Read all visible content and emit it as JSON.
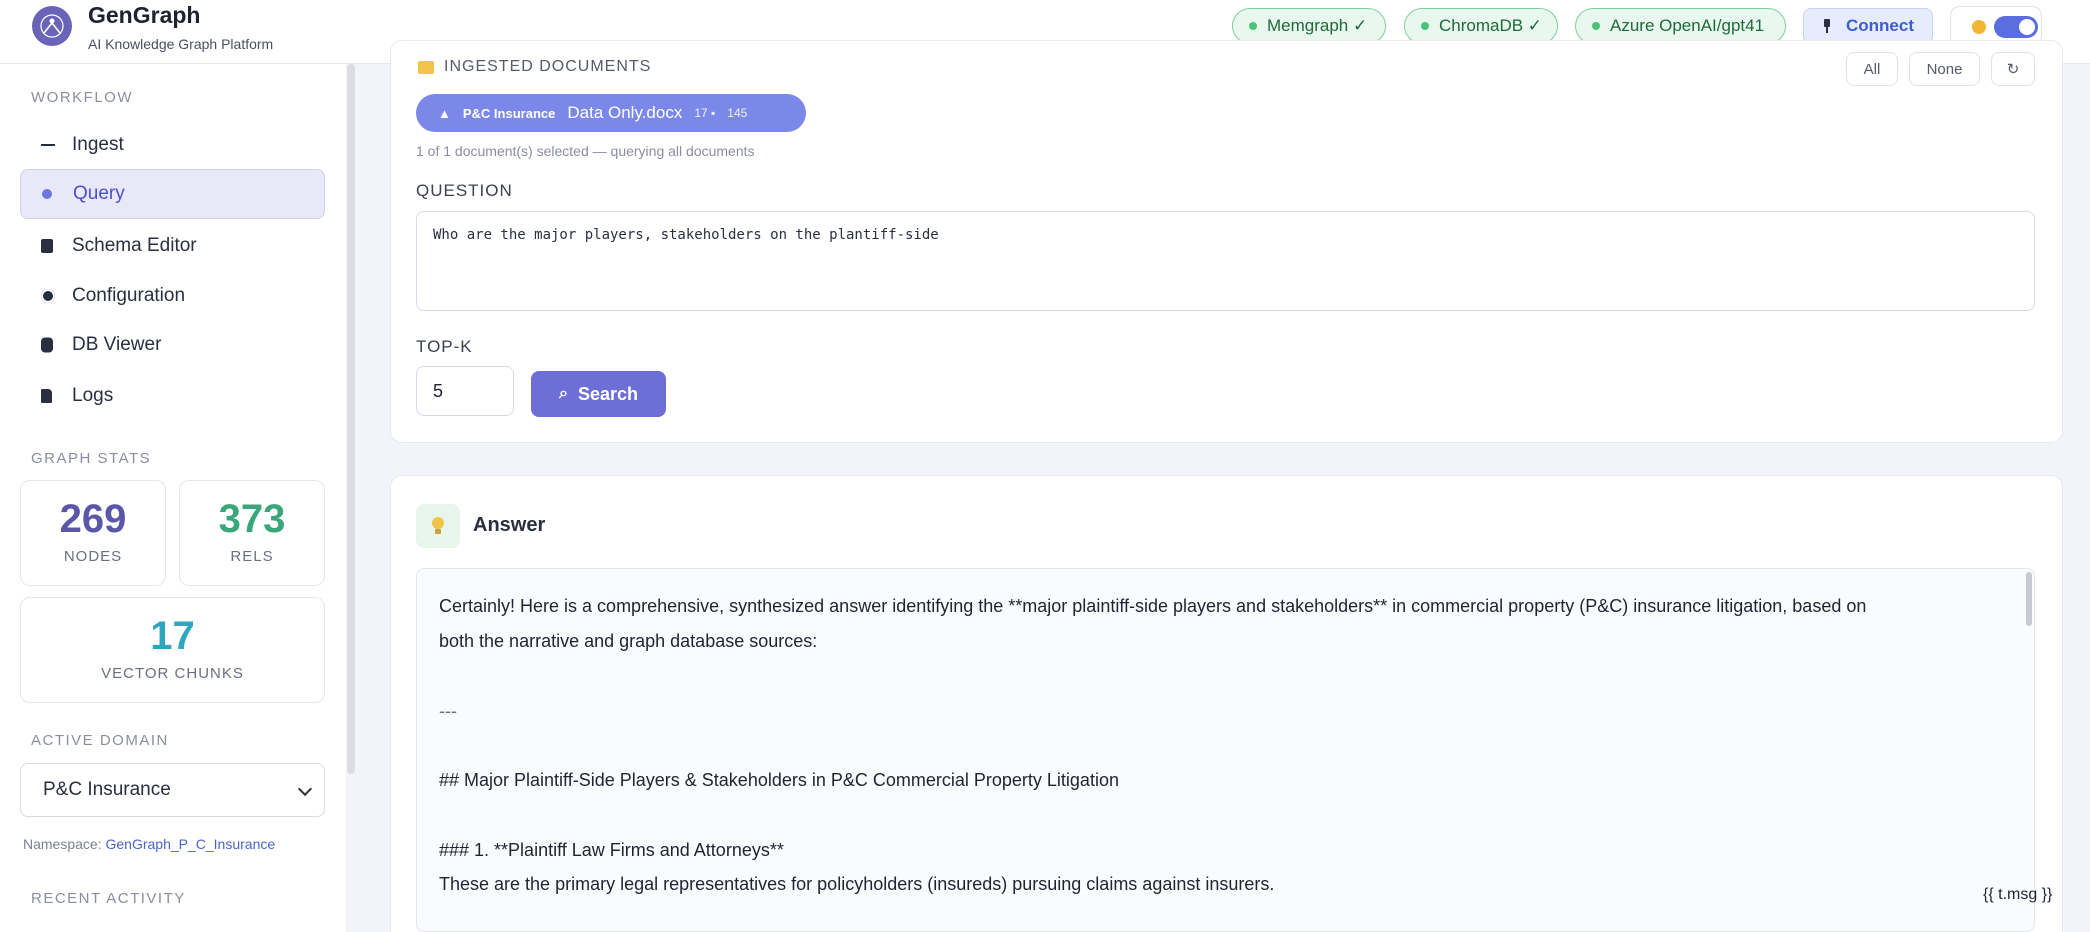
{
  "header": {
    "title": "GenGraph",
    "subtitle": "AI Knowledge Graph Platform",
    "status_pills": [
      {
        "label": "Memgraph ✓"
      },
      {
        "label": "ChromaDB ✓"
      },
      {
        "label": "Azure OpenAI/gpt41"
      }
    ],
    "connect_label": "Connect"
  },
  "sidebar": {
    "workflow_label": "WORKFLOW",
    "nav": [
      {
        "label": "Ingest"
      },
      {
        "label": "Query"
      },
      {
        "label": "Schema Editor"
      },
      {
        "label": "Configuration"
      },
      {
        "label": "DB Viewer"
      },
      {
        "label": "Logs"
      }
    ],
    "graph_stats_label": "GRAPH STATS",
    "stats": {
      "nodes_value": "269",
      "nodes_label": "NODES",
      "rels_value": "373",
      "rels_label": "RELS",
      "chunks_value": "17",
      "chunks_label": "VECTOR CHUNKS"
    },
    "active_domain_label": "ACTIVE DOMAIN",
    "active_domain_value": "P&C Insurance",
    "namespace_prefix": "Namespace:",
    "namespace_value": "GenGraph_P_C_Insurance",
    "recent_activity_label": "RECENT ACTIVITY"
  },
  "query": {
    "ingested_label": "INGESTED DOCUMENTS",
    "btn_all": "All",
    "btn_none": "None",
    "btn_refresh": "↻",
    "doc_chip": {
      "tag": "P&C Insurance",
      "name": "Data Only.docx",
      "count": "17",
      "size": "145"
    },
    "selection_info": "1 of 1 document(s) selected — querying all documents",
    "question_label": "QUESTION",
    "question_value": "Who are the major players, stakeholders on the plantiff-side",
    "topk_label": "TOP-K",
    "topk_value": "5",
    "search_label": "Search"
  },
  "answer": {
    "title": "Answer",
    "lines": [
      "Certainly! Here is a comprehensive, synthesized answer identifying the **major plaintiff-side players and stakeholders** in commercial property (P&C) insurance litigation, based on",
      "both the narrative and graph database sources:",
      "---",
      "## Major Plaintiff-Side Players & Stakeholders in P&C Commercial Property Litigation",
      "### 1. **Plaintiff Law Firms and Attorneys**",
      "These are the primary legal representatives for policyholders (insureds) pursuing claims against insurers."
    ]
  },
  "footer": {
    "template_msg": "{{ t.msg }}"
  },
  "colors": {
    "accent": "#6e6fd6",
    "nodes": "#5b56a8",
    "rels": "#3aa77a",
    "chunks": "#2fa5c0",
    "status_ok": "#4cc278"
  }
}
